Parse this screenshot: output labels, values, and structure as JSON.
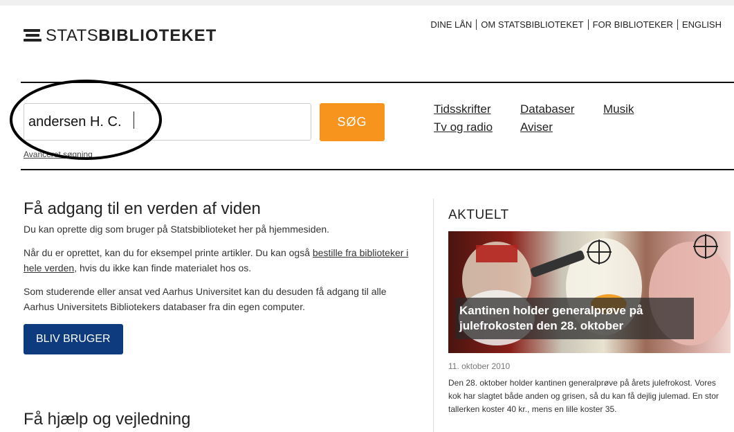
{
  "logo": {
    "prefix": "STATS",
    "bold": "BIBLIOTEKET"
  },
  "topnav": [
    "DINE LÅN",
    "OM STATSBIBLIOTEKET",
    "FOR BIBLIOTEKER",
    "ENGLISH"
  ],
  "search": {
    "value": "andersen H. C.",
    "button": "SØG",
    "advanced": "Avanceret søgning"
  },
  "quicklinks": [
    "Tidsskrifter",
    "Databaser",
    "Musik",
    "Tv og radio",
    "Aviser"
  ],
  "welcome": {
    "title": "Få adgang til en verden af viden",
    "p1": "Du kan oprette dig som bruger på Statsbiblioteket her på hjemmesiden.",
    "p2_a": "Når du er oprettet, kan du for eksempel printe artikler. Du kan også ",
    "p2_link": "bestille fra biblioteker i hele verden",
    "p2_b": ", hvis du ikke kan finde materialet hos os.",
    "p3": "Som studerende eller ansat ved Aarhus Universitet kan du desuden få adgang til alle Aarhus Universitets Bibliotekers databaser fra din egen computer.",
    "button": "BLIV BRUGER"
  },
  "help_title": "Få hjælp og vejledning",
  "news": {
    "heading": "AKTUELT",
    "caption": "Kantinen holder generalprøve på julefrokosten den 28. oktober",
    "date": "11. oktober 2010",
    "body": "Den 28. oktober holder kantinen generalprøve på årets julefrokost. Vores kok har slagtet både anden og grisen, så du kan få dejlig julemad. En stor tallerken koster 40 kr., mens en lille koster 35."
  },
  "colors": {
    "accent_orange": "#f7941d",
    "button_blue": "#0d3b7d"
  },
  "annotation": "black-ellipse-highlight"
}
